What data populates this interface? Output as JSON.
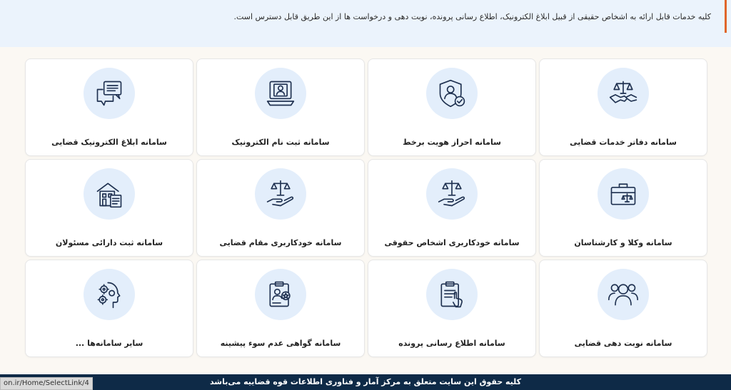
{
  "intro": {
    "text": "کلیه خدمات قابل ارائه به اشخاص حقیقی از قبیل ابلاغ الکترونیک، اطلاع رسانی پرونده، نوبت دهی و درخواست ها از این طریق قابل دسترس است."
  },
  "cards": [
    {
      "label": "سامانه دفاتر خدمات قضایی",
      "icon": "handshake-scales-icon"
    },
    {
      "label": "سامانه احراز هویت برخط",
      "icon": "shield-user-icon"
    },
    {
      "label": "سامانه ثبت نام الکترونیک",
      "icon": "laptop-user-icon"
    },
    {
      "label": "سامانه ابلاغ الکترونیک قضایی",
      "icon": "chat-bubbles-icon"
    },
    {
      "label": "سامانه وکلا و کارشناسان",
      "icon": "briefcase-scales-icon"
    },
    {
      "label": "سامانه خودکاربری اشخاص حقوقی",
      "icon": "hand-scales-icon"
    },
    {
      "label": "سامانه خودکاربری مقام قضایی",
      "icon": "hand-scales-icon"
    },
    {
      "label": "سامانه ثبت دارائی مسئولان",
      "icon": "building-checklist-icon"
    },
    {
      "label": "سامانه نوبت دهی قضایی",
      "icon": "people-group-icon"
    },
    {
      "label": "سامانه اطلاع رسانی پرونده",
      "icon": "clipboard-hand-icon"
    },
    {
      "label": "سامانه گواهی عدم سوء پیشینه",
      "icon": "clipboard-badge-icon"
    },
    {
      "label": "سایر سامانه‌ها ...",
      "icon": "head-gears-icon"
    }
  ],
  "footer": {
    "text": "کلیه حقوق این سایت متعلق به مرکز آمار و فناوری اطلاعات قوه قضاییه می‌باشد"
  },
  "status_bar": {
    "url": "on.ir/Home/SelectLink/4"
  }
}
